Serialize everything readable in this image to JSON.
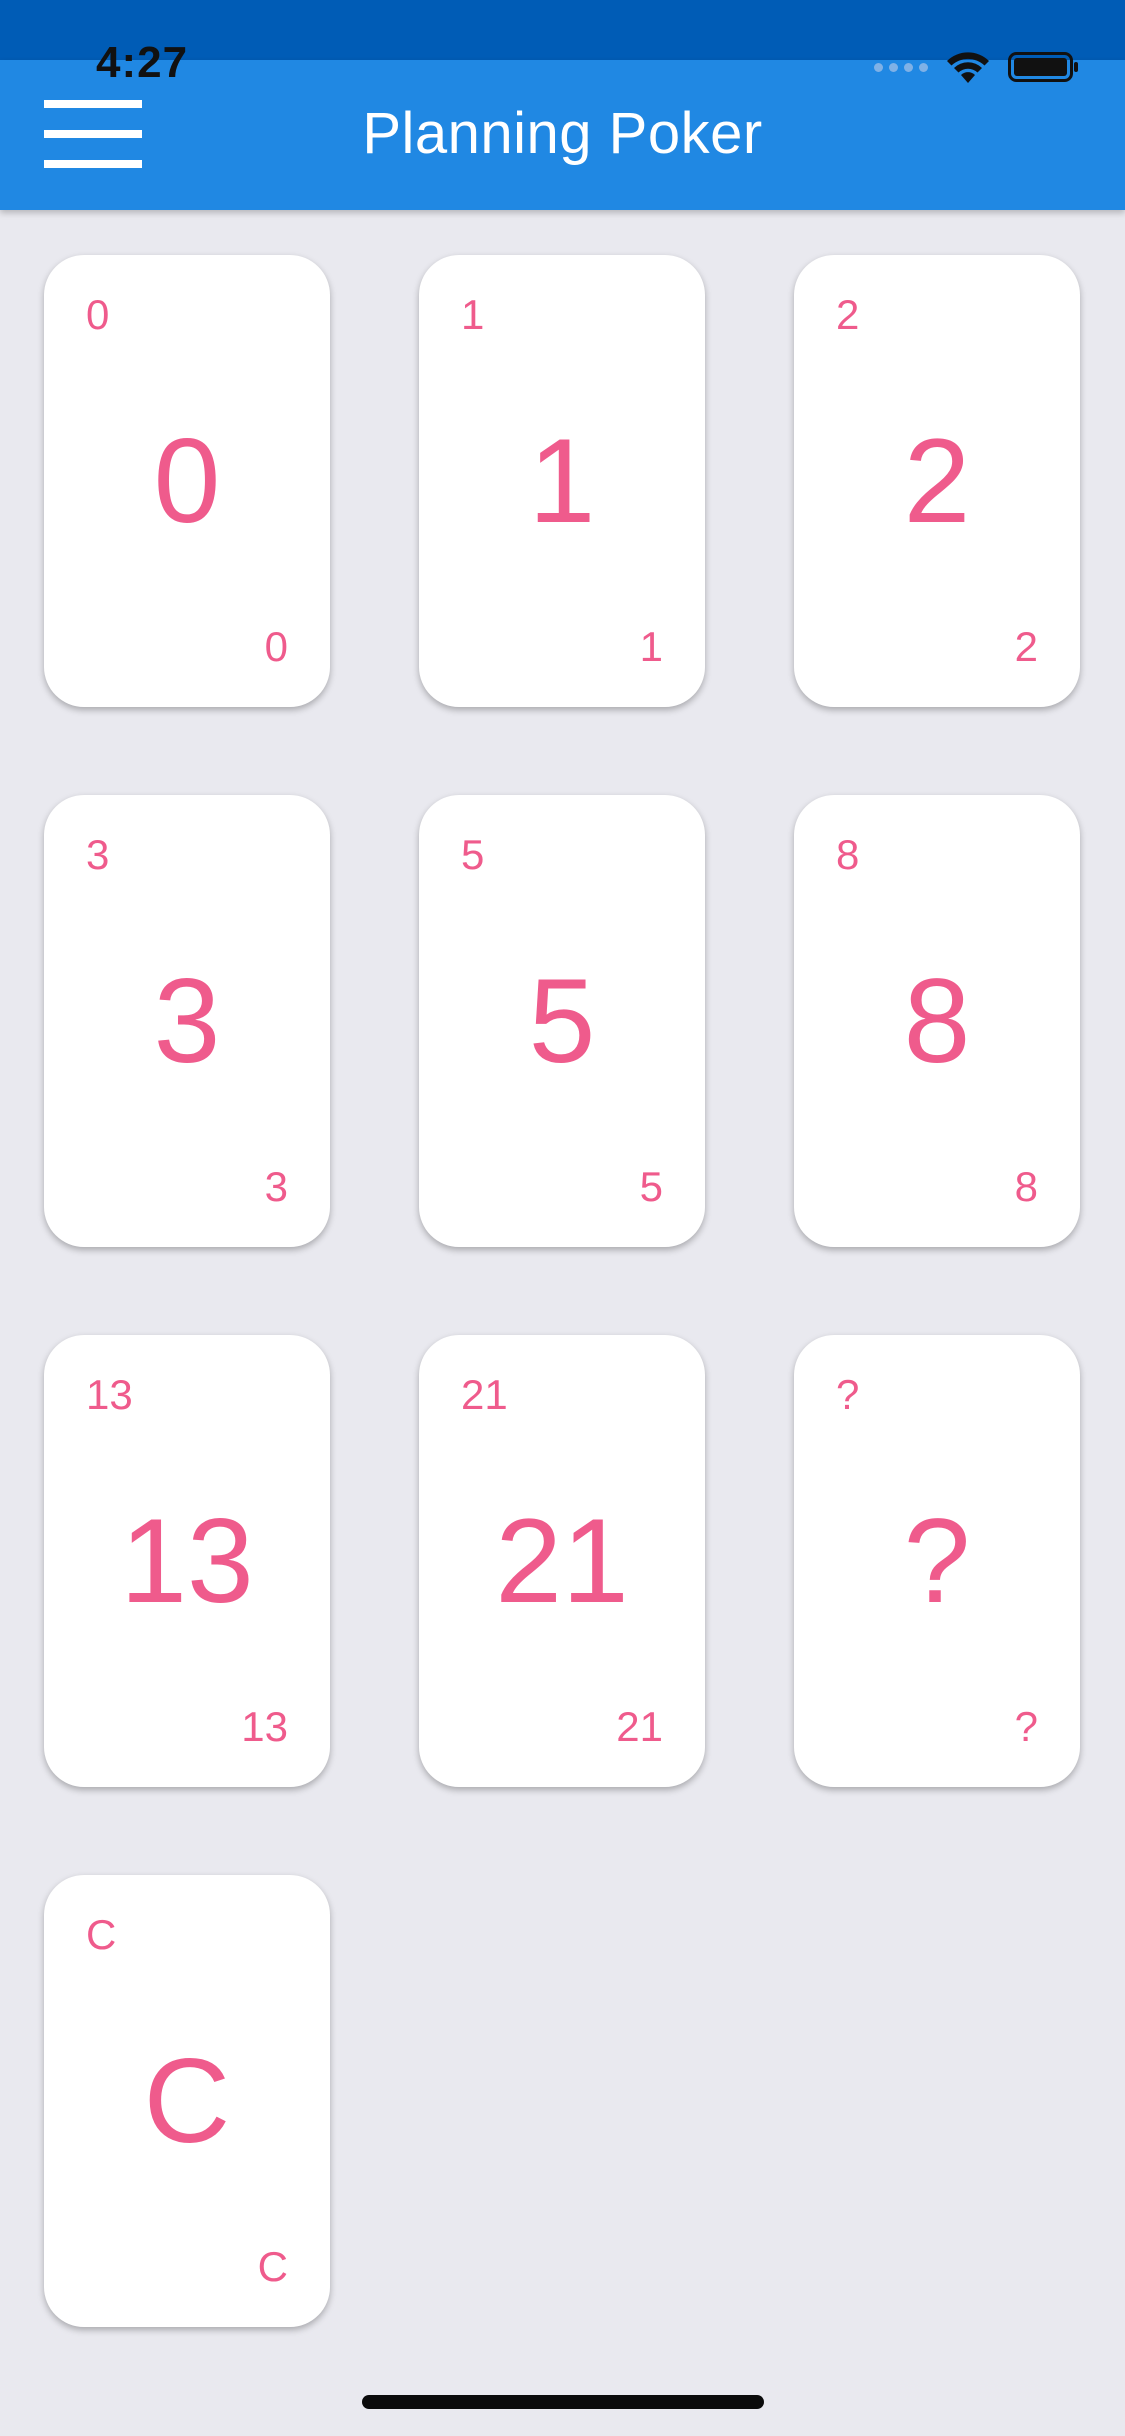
{
  "status_bar": {
    "time": "4:27",
    "icons": [
      "signal-icon",
      "wifi-icon",
      "battery-icon"
    ]
  },
  "app_bar": {
    "title": "Planning Poker",
    "menu_icon": "hamburger-menu-icon"
  },
  "cards": [
    {
      "value": "0"
    },
    {
      "value": "1"
    },
    {
      "value": "2"
    },
    {
      "value": "3"
    },
    {
      "value": "5"
    },
    {
      "value": "8"
    },
    {
      "value": "13"
    },
    {
      "value": "21"
    },
    {
      "value": "?"
    },
    {
      "value": "C"
    }
  ],
  "colors": {
    "status_bar": "#005cb6",
    "app_bar": "#2088e3",
    "background": "#e9e9ef",
    "card": "#ffffff",
    "card_text": "#ef5b8c"
  }
}
